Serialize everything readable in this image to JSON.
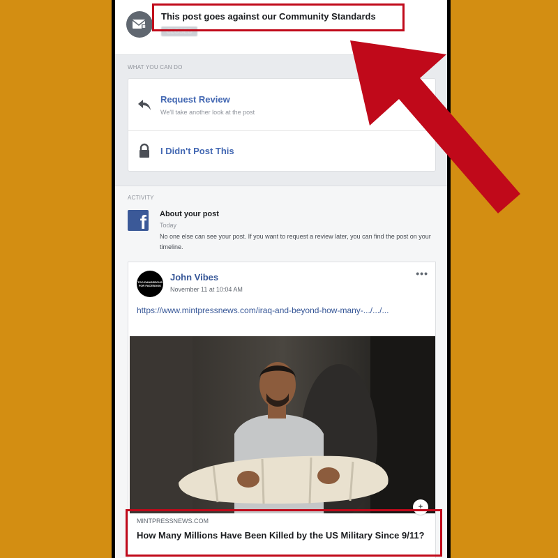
{
  "notice": {
    "title": "This post goes against our Community Standards",
    "tag": "CLOSED"
  },
  "what_you_can_do": {
    "label": "WHAT YOU CAN DO",
    "request_review": {
      "title": "Request Review",
      "subtitle": "We'll take another look at the post"
    },
    "didnt_post": {
      "title": "I Didn't Post This"
    }
  },
  "activity": {
    "label": "ACTIVITY",
    "about_title": "About your post",
    "about_when": "Today",
    "about_body": "No one else can see your post. If you want to request a review later, you can find the post on your timeline."
  },
  "post": {
    "avatar_text": "TOO DANGEROUS FOR FACEBOOK",
    "author": "John Vibes",
    "time": "November 11 at 10:04 AM",
    "more": "•••",
    "link_text": "https://www.mintpressnews.com/iraq-and-beyond-how-many-.../.../...",
    "link_domain": "MINTPRESSNEWS.COM",
    "link_title": "How Many Millions Have Been Killed by the US Military Since 9/11?",
    "share_glyph": "+"
  },
  "colors": {
    "background": "#d38e12",
    "highlight_red": "#c0091a",
    "facebook_blue": "#3b5998",
    "link_blue": "#4267b2"
  },
  "icons": [
    "envelope-warning-icon",
    "reply-arrow-icon",
    "lock-icon",
    "facebook-logo-icon",
    "more-dots-icon"
  ]
}
